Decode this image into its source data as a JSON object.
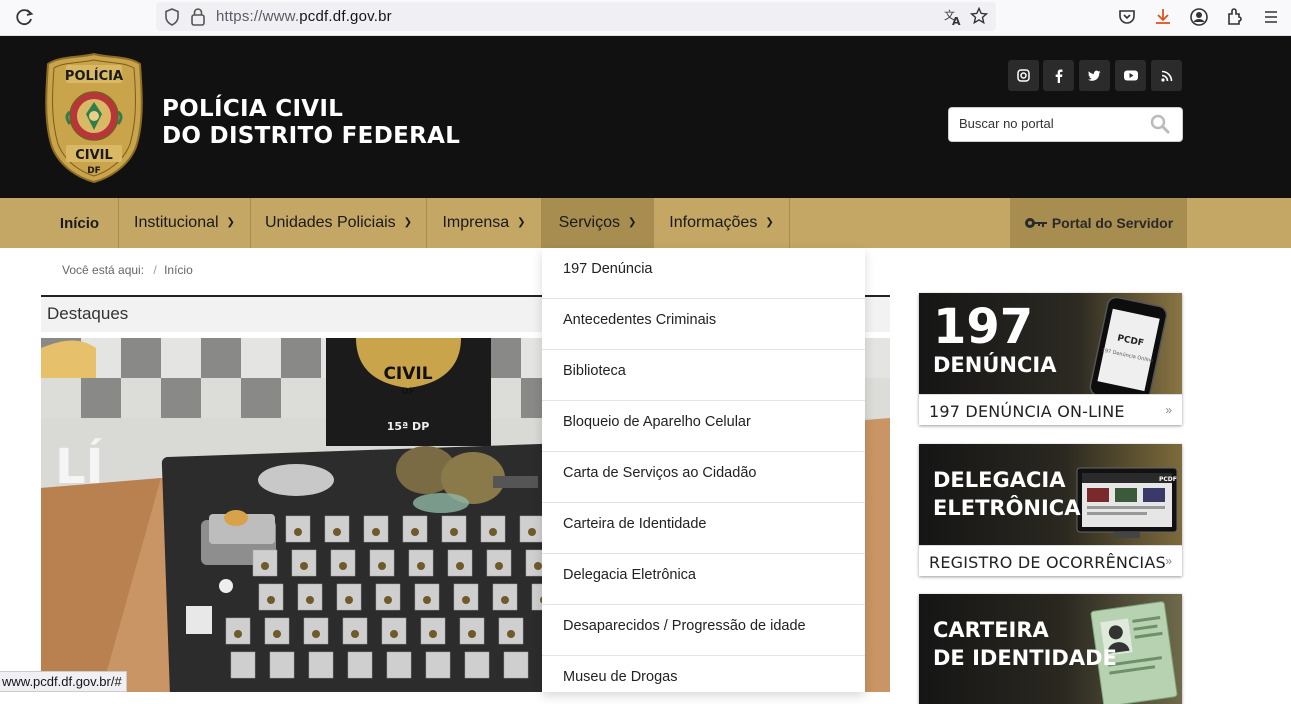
{
  "browser": {
    "url_prefix": "https://www.",
    "url_domain": "pcdf.df.gov.br",
    "status_url": "www.pcdf.df.gov.br/#"
  },
  "header": {
    "badge_top": "POLÍCIA",
    "badge_bottom": "CIVIL",
    "badge_df": "DF",
    "title_line1": "POLÍCIA CIVIL",
    "title_line2": "DO DISTRITO FEDERAL",
    "search_placeholder": "Buscar no portal",
    "social": [
      "instagram-icon",
      "facebook-icon",
      "twitter-icon",
      "youtube-icon",
      "rss-icon"
    ]
  },
  "nav": {
    "items": [
      {
        "label": "Início"
      },
      {
        "label": "Institucional"
      },
      {
        "label": "Unidades Policiais"
      },
      {
        "label": "Imprensa"
      },
      {
        "label": "Serviços"
      },
      {
        "label": "Informações"
      }
    ],
    "portal_label": "Portal do Servidor",
    "active": "Serviços"
  },
  "breadcrumb": {
    "prefix": "Você está aqui:",
    "current": "Início"
  },
  "destaques": {
    "title": "Destaques",
    "photo_texts": [
      "CIVIL",
      "DF",
      "15ª DP",
      "LÍ"
    ]
  },
  "dropdown": {
    "items": [
      "197 Denúncia",
      "Antecedentes Criminais",
      "Biblioteca",
      "Bloqueio de Aparelho Celular",
      "Carta de Serviços ao Cidadão",
      "Carteira de Identidade",
      "Delegacia Eletrônica",
      "Desaparecidos / Progressão de idade",
      "Museu de Drogas"
    ]
  },
  "banners": [
    {
      "big1": "197",
      "big2": "DENÚNCIA",
      "bar": "197 DENÚNCIA ON-LINE",
      "phone_text": "PCDF",
      "phone_sub": "197 Denúncia Online"
    },
    {
      "big1": "DELEGACIA",
      "big2": "ELETRÔNICA",
      "bar": "REGISTRO DE OCORRÊNCIAS",
      "screen_text": "PCDF"
    },
    {
      "big1": "CARTEIRA",
      "big2": "DE IDENTIDADE"
    }
  ],
  "colors": {
    "header_bg": "#111111",
    "nav_bg": "#c4a765",
    "nav_active": "#a88d50",
    "gold": "#c9a44a"
  }
}
